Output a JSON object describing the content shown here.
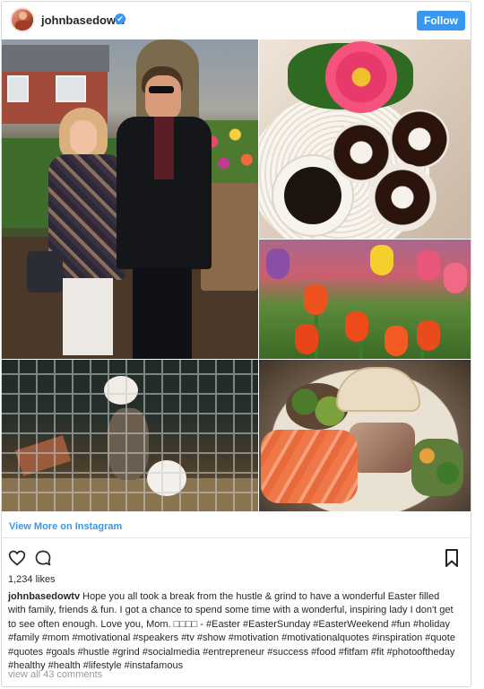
{
  "post": {
    "username": "johnbasedowtv",
    "verified_mark": "✔",
    "follow_label": "Follow",
    "view_more_label": "View More on Instagram",
    "likes": "1,234 likes",
    "caption_user": "johnbasedowtv",
    "caption_text": "Hope you all took a break from the hustle & grind to have a wonderful Easter filled with family, friends & fun. I got a chance to spend some time with a wonderful, inspiring lady I don't get to see often enough. Love you, Mom. □□□□ - #Easter #EasterSunday #EasterWeekend #fun #holiday #family #mom #motivational #speakers #tv #show #motivation #motivationalquotes #inspiration #quote #quotes #goals #hustle #grind #socialmedia #entrepreneur #success #food #fitfam #fit #photooftheday #healthy #health #lifestyle #instafamous",
    "view_all_comments": "view all 43 comments"
  },
  "icons": {
    "avatar": "avatar-icon",
    "verified": "verified-badge-icon",
    "like": "heart-icon",
    "comment": "comment-icon",
    "save": "bookmark-icon"
  },
  "colors": {
    "accent": "#3897f0",
    "text": "#262626",
    "muted": "#999999"
  }
}
